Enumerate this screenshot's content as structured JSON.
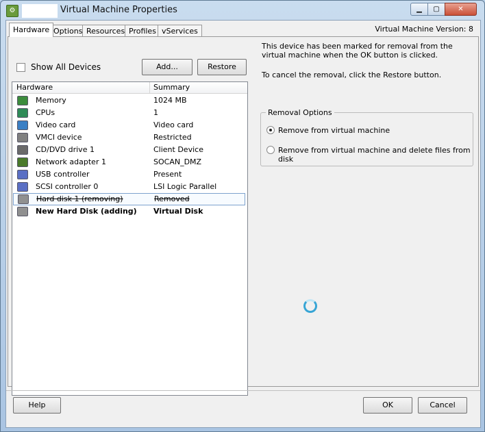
{
  "window": {
    "title": "Virtual Machine Properties",
    "app_icon": "vsphere-icon",
    "controls": {
      "minimize": "▁",
      "maximize": "▢",
      "close": "✕"
    }
  },
  "tabs": [
    "Hardware",
    "Options",
    "Resources",
    "Profiles",
    "vServices"
  ],
  "active_tab": "Hardware",
  "vm_version": "Virtual Machine Version: 8",
  "toolbar": {
    "show_all_devices": "Show All Devices",
    "add": "Add...",
    "restore": "Restore"
  },
  "hardware_list": {
    "columns": [
      "Hardware",
      "Summary"
    ],
    "rows": [
      {
        "name": "Memory",
        "summary": "1024 MB",
        "icon": "memory-icon",
        "color": "#3c8c3c"
      },
      {
        "name": "CPUs",
        "summary": "1",
        "icon": "cpu-icon",
        "color": "#2e8b57"
      },
      {
        "name": "Video card",
        "summary": "Video card",
        "icon": "monitor-icon",
        "color": "#3b7fc4"
      },
      {
        "name": "VMCI device",
        "summary": "Restricted",
        "icon": "device-icon",
        "color": "#808080"
      },
      {
        "name": "CD/DVD drive 1",
        "summary": "Client Device",
        "icon": "cd-drive-icon",
        "color": "#6a6a6a"
      },
      {
        "name": "Network adapter 1",
        "summary": "SOCAN_DMZ",
        "icon": "network-icon",
        "color": "#4a7a2a"
      },
      {
        "name": "USB controller",
        "summary": "Present",
        "icon": "usb-icon",
        "color": "#5a6fc4"
      },
      {
        "name": "SCSI controller 0",
        "summary": "LSI Logic Parallel",
        "icon": "scsi-icon",
        "color": "#5a6fc4"
      },
      {
        "name": "Hard disk 1 (removing)",
        "summary": "Removed",
        "icon": "hard-disk-icon",
        "color": "#909090",
        "state": "removing"
      },
      {
        "name": "New Hard Disk (adding)",
        "summary": "Virtual Disk",
        "icon": "hard-disk-icon",
        "color": "#909090",
        "state": "adding"
      }
    ]
  },
  "details": {
    "removal_notice": "This device has been marked for removal from the virtual machine when the OK button is clicked.",
    "restore_notice": "To cancel the removal, click the Restore button.",
    "removal_options": {
      "title": "Removal Options",
      "options": [
        "Remove from virtual machine",
        "Remove from virtual machine and delete files from disk"
      ],
      "selected": "Remove from virtual machine"
    }
  },
  "footer": {
    "help": "Help",
    "ok": "OK",
    "cancel": "Cancel"
  }
}
